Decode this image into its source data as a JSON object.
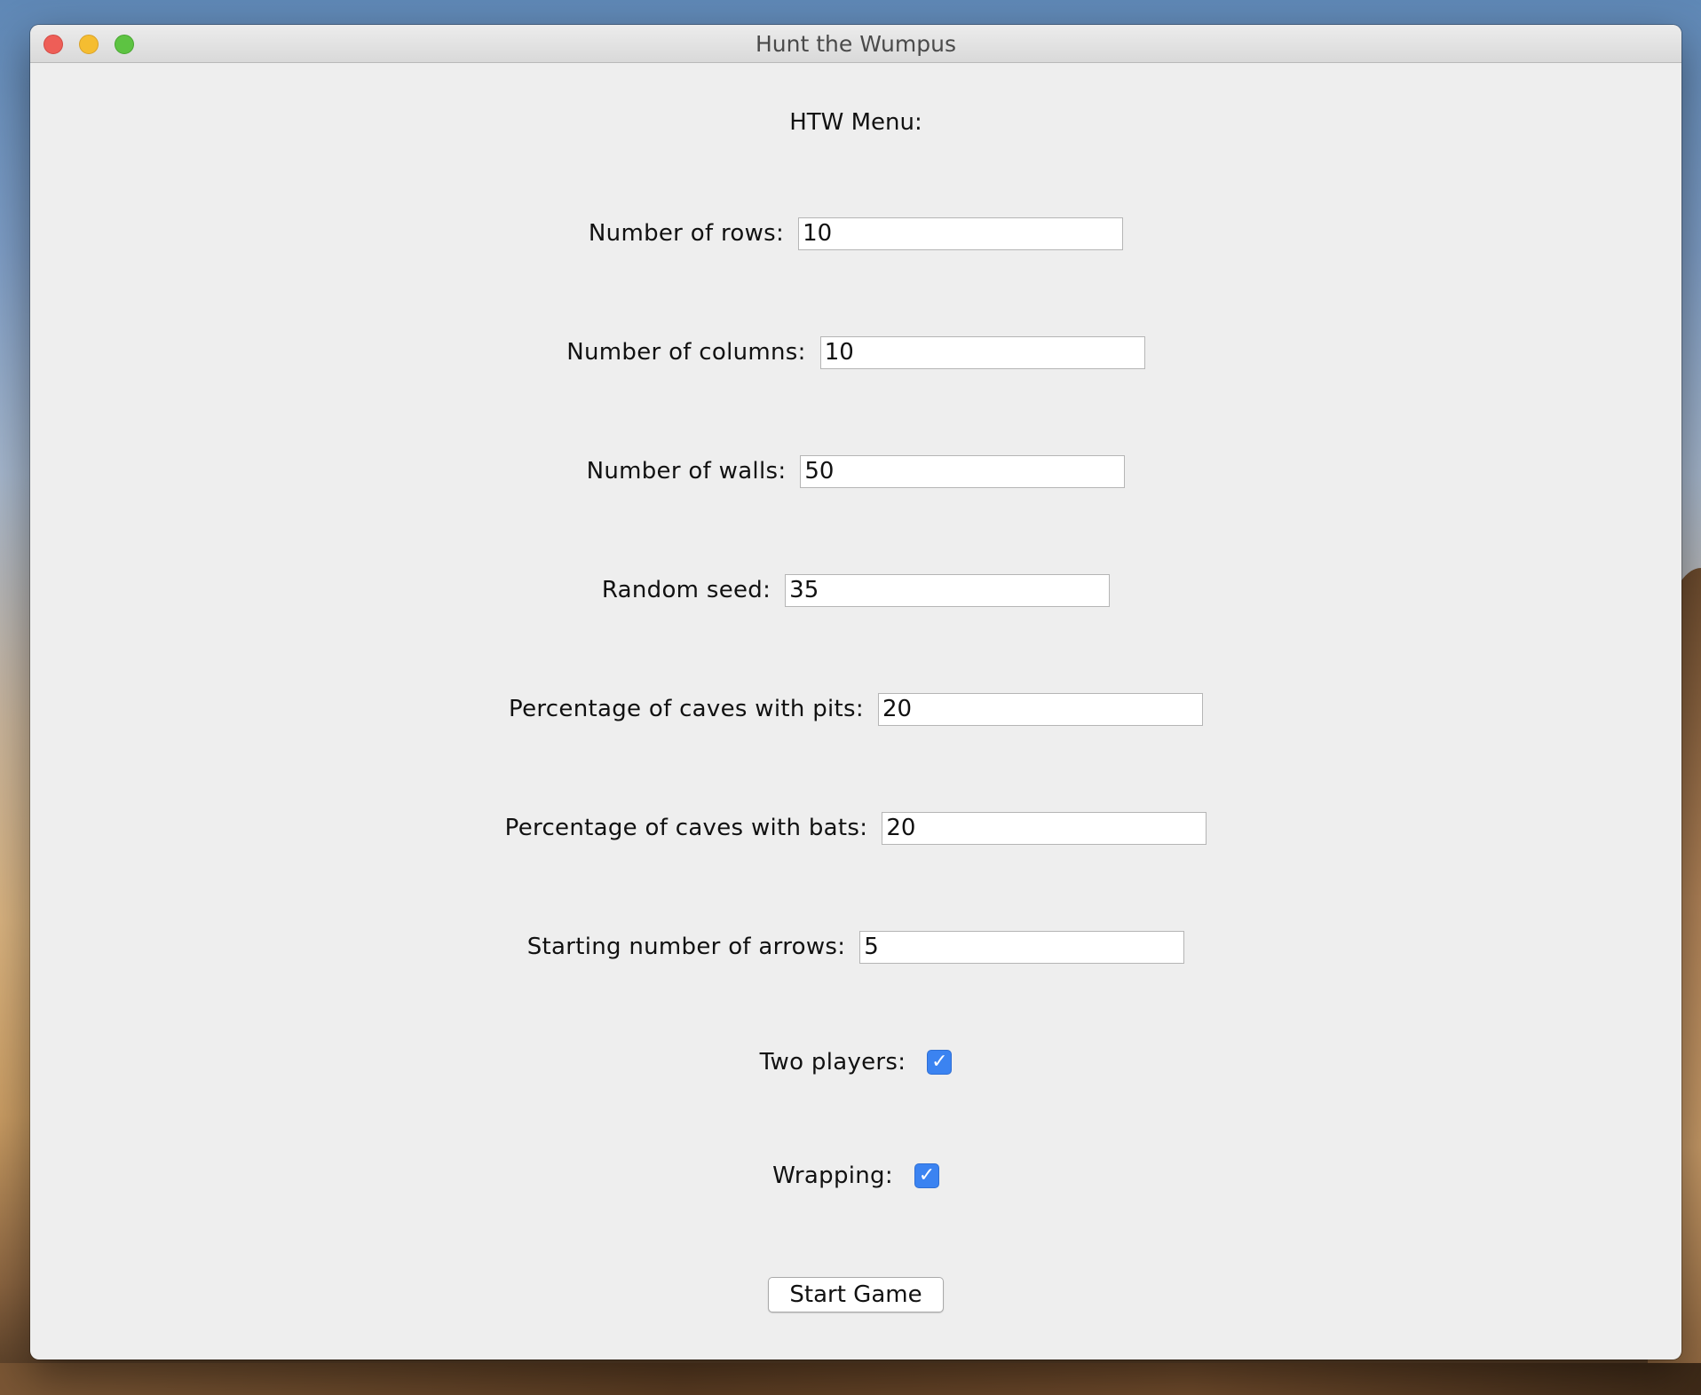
{
  "window": {
    "title": "Hunt the Wumpus"
  },
  "menu": {
    "title": "HTW Menu:"
  },
  "fields": [
    {
      "label": "Number of rows:",
      "value": "10"
    },
    {
      "label": "Number of columns:",
      "value": "10"
    },
    {
      "label": "Number of walls:",
      "value": "50"
    },
    {
      "label": "Random seed:",
      "value": "35"
    },
    {
      "label": "Percentage of caves with pits:",
      "value": "20"
    },
    {
      "label": "Percentage of caves with bats:",
      "value": "20"
    },
    {
      "label": "Starting number of arrows:",
      "value": "5"
    }
  ],
  "checkboxes": [
    {
      "label": "Two players:",
      "checked": true
    },
    {
      "label": "Wrapping:",
      "checked": true
    }
  ],
  "button": {
    "label": "Start Game"
  },
  "colors": {
    "accent": "#3b83f1",
    "window_bg": "#eeeeee",
    "close": "#ee5e57",
    "minimize": "#f5bd31",
    "zoom": "#5dc342"
  },
  "icons": {
    "check": "check-mark-icon"
  }
}
